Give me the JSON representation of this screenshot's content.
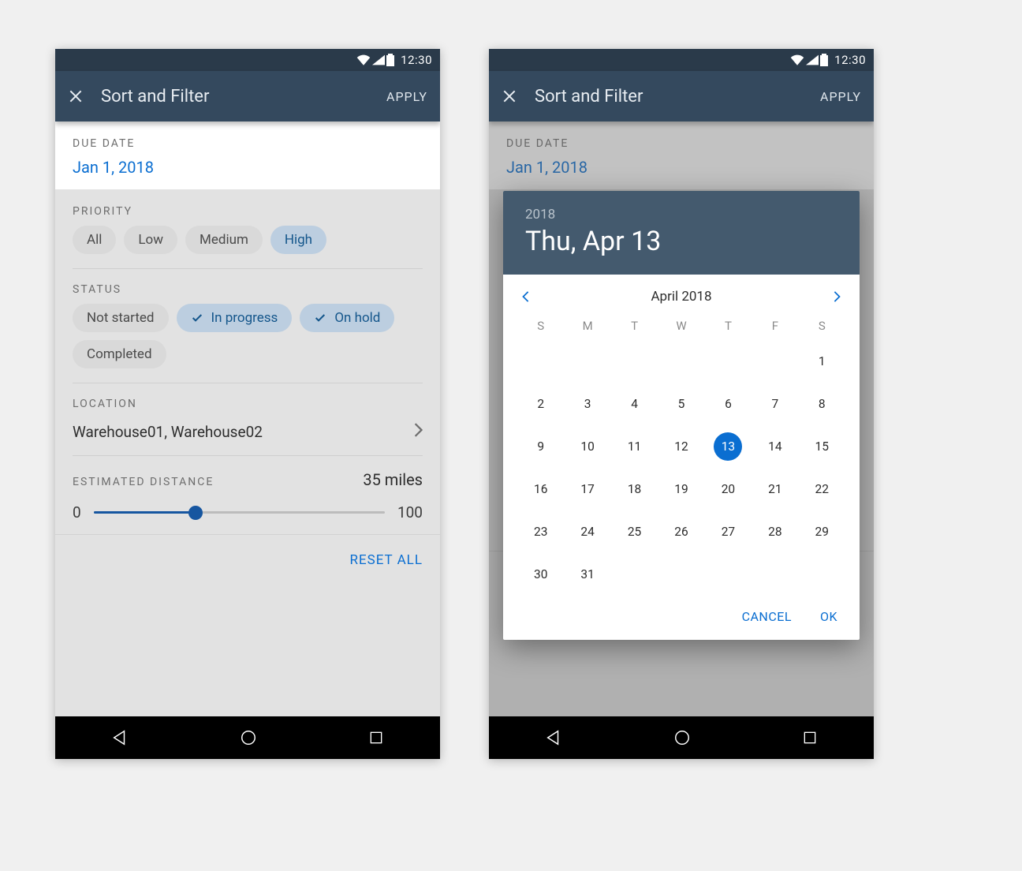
{
  "status": {
    "time": "12:30"
  },
  "appbar": {
    "title": "Sort and Filter",
    "apply": "APPLY"
  },
  "filter": {
    "due_date_label": "DUE DATE",
    "due_date_value": "Jan 1, 2018",
    "priority_label": "PRIORITY",
    "priority_chips": [
      "All",
      "Low",
      "Medium",
      "High"
    ],
    "status_label": "STATUS",
    "status_chips": [
      "Not started",
      "In progress",
      "On hold",
      "Completed"
    ],
    "location_label": "LOCATION",
    "location_value": "Warehouse01, Warehouse02",
    "distance_label": "ESTIMATED DISTANCE",
    "distance_value": "35 miles",
    "slider": {
      "min": "0",
      "max": "100",
      "value_pct": 35
    },
    "reset": "RESET ALL"
  },
  "datepicker": {
    "year": "2018",
    "headline": "Thu, Apr 13",
    "month_label": "April 2018",
    "dow": [
      "S",
      "M",
      "T",
      "W",
      "T",
      "F",
      "S"
    ],
    "leading_blanks": 6,
    "days": 31,
    "selected": 13,
    "cancel": "CANCEL",
    "ok": "OK"
  }
}
